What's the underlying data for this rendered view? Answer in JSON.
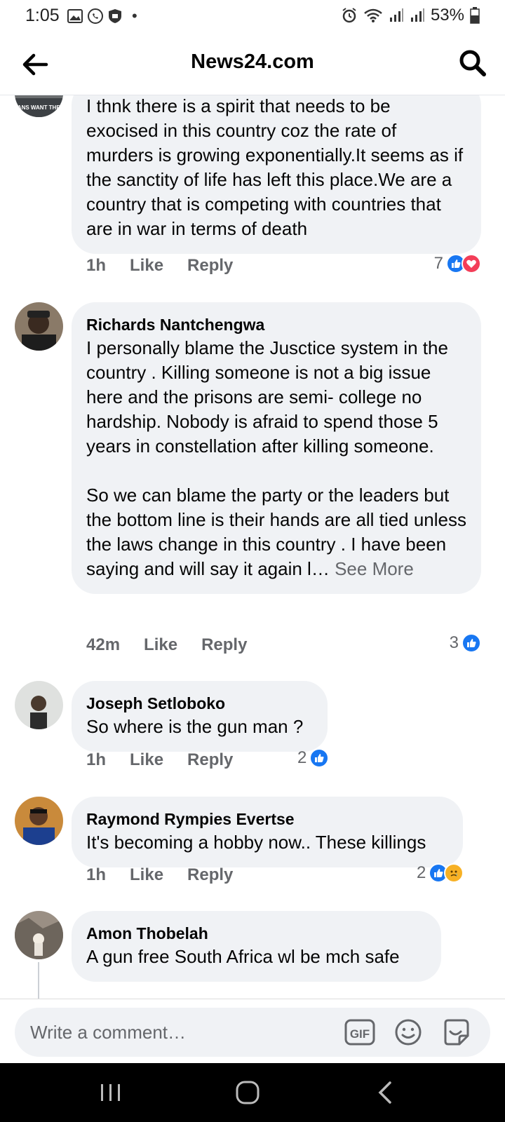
{
  "status_bar": {
    "time": "1:05",
    "dot": "•",
    "battery": "53%"
  },
  "header": {
    "title": "News24.com"
  },
  "comments": [
    {
      "author": "",
      "avatar_text": "ERICANS WANT THE SKY",
      "text": "I thnk there is a spirit that needs to be exocised in this country coz the rate of murders is growing exponentially.It seems as if the sanctity of life has left this place.We are a country that is competing with countries that are in war in terms of death",
      "time": "1h",
      "like": "Like",
      "reply": "Reply",
      "reactions_count": "7",
      "reactions": [
        "like-icon",
        "love-icon"
      ]
    },
    {
      "author": "Richards Nantchengwa",
      "text": "I personally blame the Jusctice system  in the country . Killing someone is not a big issue here and the prisons are  semi- college no hardship. Nobody is afraid to spend those 5 years in constellation  after killing someone.\n\nSo we can blame the party or the leaders but the bottom line is their hands are all tied unless the laws change in this country . I have been saying and will say it again l…",
      "see_more": "See More",
      "time": "42m",
      "like": "Like",
      "reply": "Reply",
      "reactions_count": "3",
      "reactions": [
        "like-icon"
      ]
    },
    {
      "author": "Joseph Setloboko",
      "text": "So where is the gun man ?",
      "time": "1h",
      "like": "Like",
      "reply": "Reply",
      "reactions_count": "2",
      "reactions": [
        "like-icon"
      ]
    },
    {
      "author": "Raymond Rympies Evertse",
      "text": "It's becoming a hobby now.. These killings",
      "time": "1h",
      "like": "Like",
      "reply": "Reply",
      "reactions_count": "2",
      "reactions": [
        "like-icon",
        "sad-icon"
      ]
    },
    {
      "author": "Amon Thobelah",
      "text": "A gun free  South Africa wl be mch safe"
    }
  ],
  "composer": {
    "placeholder": "Write a comment…",
    "gif_label": "GIF"
  },
  "colors": {
    "like": "#1877f2",
    "love": "#f33e58",
    "sad": "#f7b125",
    "bubble": "#f0f2f5",
    "secondary_text": "#65676b"
  }
}
